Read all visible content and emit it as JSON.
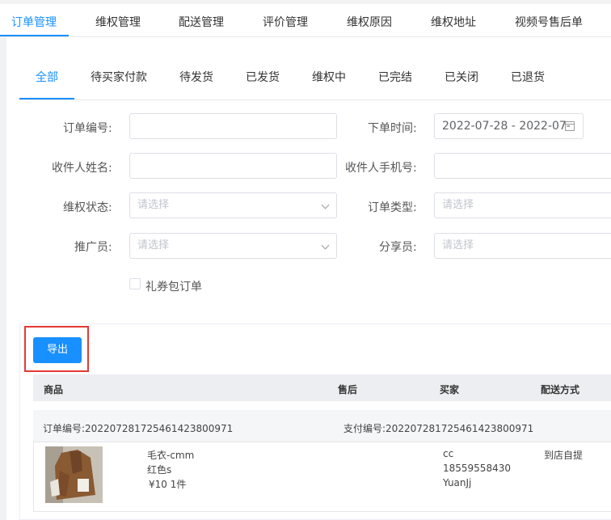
{
  "top_tabs": [
    {
      "label": "订单管理",
      "active": true
    },
    {
      "label": "维权管理",
      "active": false
    },
    {
      "label": "配送管理",
      "active": false
    },
    {
      "label": "评价管理",
      "active": false
    },
    {
      "label": "维权原因",
      "active": false
    },
    {
      "label": "维权地址",
      "active": false
    },
    {
      "label": "视频号售后单",
      "active": false
    }
  ],
  "status_tabs": [
    {
      "label": "全部",
      "active": true
    },
    {
      "label": "待买家付款",
      "active": false
    },
    {
      "label": "待发货",
      "active": false
    },
    {
      "label": "已发货",
      "active": false
    },
    {
      "label": "维权中",
      "active": false
    },
    {
      "label": "已完结",
      "active": false
    },
    {
      "label": "已关闭",
      "active": false
    },
    {
      "label": "已退货",
      "active": false
    }
  ],
  "filters": {
    "order_no_label": "订单编号:",
    "order_no_value": "",
    "order_time_label": "下单时间:",
    "order_time_value": "2022-07-28 - 2022-07-",
    "receiver_name_label": "收件人姓名:",
    "receiver_name_value": "",
    "receiver_phone_label": "收件人手机号:",
    "receiver_phone_value": "",
    "rights_status_label": "维权状态:",
    "rights_status_placeholder": "请选择",
    "order_type_label": "订单类型:",
    "order_type_placeholder": "请选择",
    "promoter_label": "推广员:",
    "promoter_placeholder": "请选择",
    "sharer_label": "分享员:",
    "sharer_placeholder": "请选择",
    "gift_coupon_label": "礼券包订单",
    "gift_coupon_checked": false
  },
  "actions": {
    "export_label": "导出"
  },
  "table": {
    "columns": [
      "商品",
      "售后",
      "买家",
      "配送方式"
    ]
  },
  "order": {
    "order_no": "订单编号:2022072817254614238009​71",
    "pay_no": "支付编号:2022072817254614238009​71",
    "product_name": "毛衣-cmm",
    "product_spec": "红色s",
    "product_price_qty": "¥10   1件",
    "buyer_name": "cc",
    "buyer_phone": "18559558430",
    "buyer_nick": "YuanJj",
    "delivery": "到店自提"
  },
  "colors": {
    "accent": "#1890ff",
    "highlight": "#e53935"
  }
}
